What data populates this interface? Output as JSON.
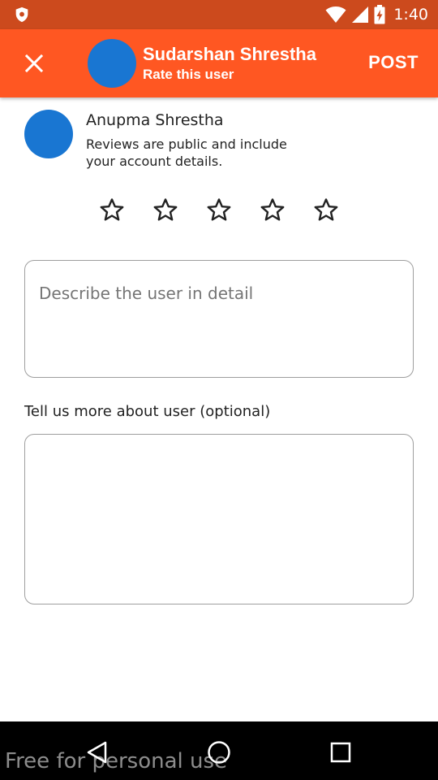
{
  "status_bar": {
    "time": "1:40",
    "icons": [
      "shield-icon",
      "wifi-icon",
      "signal-icon",
      "battery-charging-icon"
    ],
    "color": "#cc4a1d"
  },
  "app_bar": {
    "title": "Sudarshan Shrestha",
    "subtitle": "Rate this user",
    "action_label": "POST",
    "close_icon": "close-icon",
    "color": "#ff5722"
  },
  "reviewer": {
    "name": "Anupma Shrestha",
    "notice": "Reviews are public and include\n your account details."
  },
  "rating": {
    "max": 5,
    "value": 0,
    "icon": "star-outline-icon"
  },
  "describe_field": {
    "placeholder": "Describe the user in detail",
    "value": ""
  },
  "more_field": {
    "label": "Tell us more about user (optional)",
    "value": ""
  },
  "nav_bar": {
    "buttons": [
      "back-icon",
      "home-icon",
      "recents-icon"
    ]
  },
  "watermark": "Free for personal use",
  "colors": {
    "accent": "#ff5722",
    "avatar": "#1976d2"
  }
}
